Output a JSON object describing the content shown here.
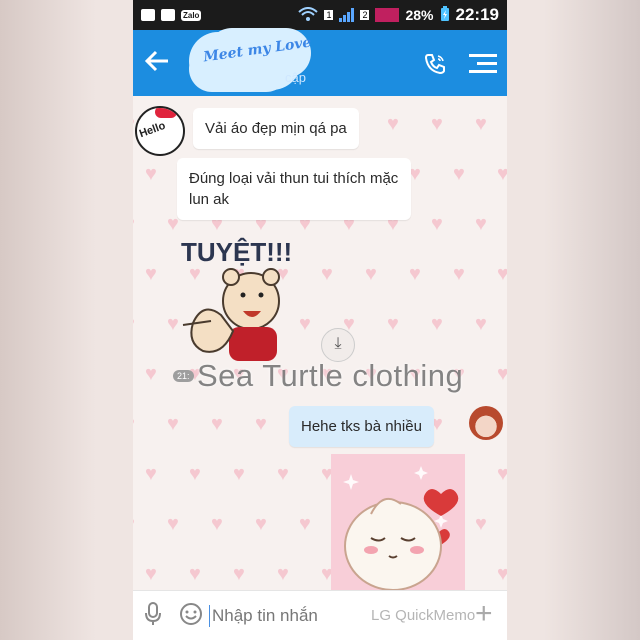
{
  "status_bar": {
    "zalo_label": "Zalo",
    "sim_number": "1",
    "sim2_number": "2",
    "battery": "28%",
    "time": "22:19"
  },
  "header": {
    "title_art": "Meet my Love",
    "subtitle": "cập"
  },
  "messages": [
    {
      "from": "them",
      "text": "Vải áo đẹp mịn qá pa"
    },
    {
      "from": "them",
      "text": "Đúng loại vải thun tui thích mặc lun ak"
    },
    {
      "from": "them",
      "type": "sticker",
      "text": "TUYỆT!!!"
    },
    {
      "from": "me",
      "text": "Hehe tks bà nhiều"
    },
    {
      "from": "me",
      "type": "sticker"
    }
  ],
  "timestamp": "21:",
  "watermark": "Sea Turtle clothing",
  "input": {
    "placeholder": "Nhập tin nhắn",
    "overlay": "LG QuickMemo"
  },
  "colors": {
    "appbar": "#1c8de0",
    "status_bar": "#1b1b1b",
    "my_bubble": "#d8ecfb",
    "chat_bg": "#f7f1ef"
  },
  "icons": [
    "back-arrow-icon",
    "phone-icon",
    "menu-icon",
    "mic-icon",
    "emoji-icon",
    "plus-icon",
    "download-icon",
    "wifi-icon",
    "battery-icon"
  ]
}
